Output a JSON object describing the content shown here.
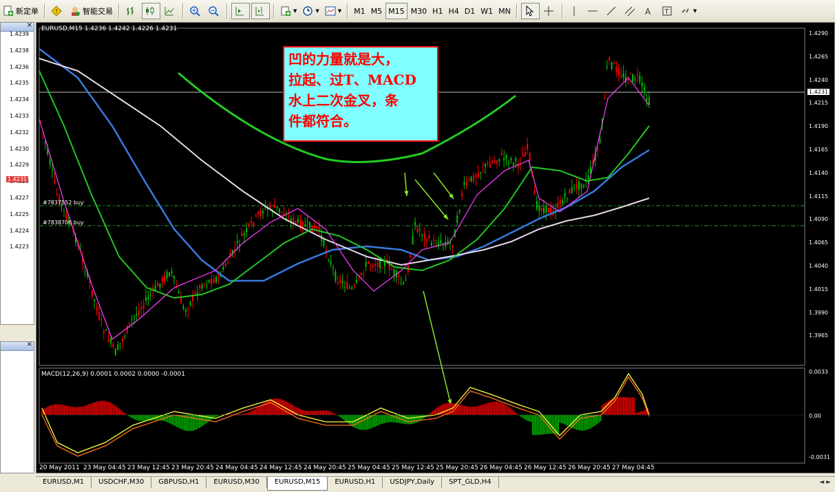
{
  "toolbar": {
    "new_order": "新定单",
    "expert_advisors": "智能交易",
    "timeframes": [
      "M1",
      "M5",
      "M15",
      "M30",
      "H1",
      "H4",
      "D1",
      "W1",
      "MN"
    ],
    "active_timeframe": "M15"
  },
  "chart": {
    "header": "EURUSD,M15  1.4236 1.4242 1.4226 1.4231",
    "current_price": "1.4231",
    "price_axis": [
      "1.4290",
      "1.4265",
      "1.4240",
      "1.4215",
      "1.4190",
      "1.4165",
      "1.4140",
      "1.4115",
      "1.4090",
      "1.4065",
      "1.4040",
      "1.4015",
      "1.3990",
      "1.3965"
    ],
    "orders": [
      "#7837552 buy",
      "#7838706 buy"
    ],
    "annotation": [
      "凹的力量就是大，",
      "拉起、过T、MACD",
      "水上二次金叉，条",
      "件都符合。"
    ],
    "macd_header": "MACD(12,26,9) 0.0001 0.0002 0.0000 -0.0001",
    "macd_axis": [
      "0.0033",
      "0.00",
      "-0.0031"
    ],
    "dates": [
      "20 May 2011",
      "23 May 04:45",
      "23 May 12:45",
      "23 May 20:45",
      "24 May 04:45",
      "24 May 12:45",
      "24 May 20:45",
      "25 May 04:45",
      "25 May 12:45",
      "25 May 20:45",
      "26 May 04:45",
      "26 May 12:45",
      "26 May 20:45",
      "27 May 04:45"
    ]
  },
  "left_panel": {
    "prices": [
      "1.4239",
      "1.4238",
      "1.4236",
      "1.4235",
      "1.4234",
      "1.4233",
      "1.4232",
      "1.4230",
      "1.4229",
      "1.4228",
      "1.4227",
      "1.4225",
      "1.4224",
      "1.4223"
    ],
    "current": "1.4231"
  },
  "tabs": [
    "EURUSD,M1",
    "USDCHF,M30",
    "GBPUSD,H1",
    "EURUSD,M30",
    "EURUSD,M15",
    "EURUSD,H1",
    "USDJPY,Daily",
    "SPT_GLD,H4"
  ],
  "active_tab": "EURUSD,M15",
  "colors": {
    "background": "#000000",
    "bull": "#00c000",
    "bear": "#ff0000",
    "ma_blue": "#3a7ae0",
    "ma_white": "#e8d8e8",
    "ma_green": "#22c822"
  }
}
